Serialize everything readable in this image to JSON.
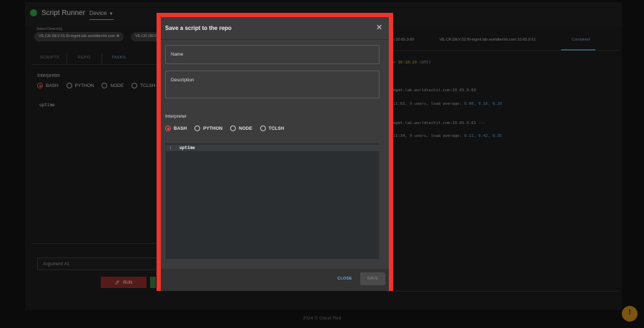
{
  "app": {
    "title": "Script Runner",
    "device_select": "Device",
    "devices_label": "Select Device(s)",
    "device_chips": [
      "VE.CR.DEV.01.f0-mgmt.lab.worldtechit.com",
      "VE.CR.DEV"
    ],
    "left_tabs": [
      "SCRIPTS",
      "REPO",
      "TASKS"
    ],
    "interpreter_label": "Interpreter",
    "interpreters": [
      "BASH",
      "PYTHON",
      "NODE",
      "TCLSH"
    ],
    "selected_interpreter": "BASH",
    "script_line": "uptime",
    "argument_placeholder": "Argument #1",
    "run_label": "RUN"
  },
  "output": {
    "tabs": [
      ".com:10.65.9.60",
      "VE.CR.DEV.02.f0-mgmt.lab.worldtechit.com:10.65.9.61",
      "Combined"
    ],
    "lines": {
      "l1_pre": "n ",
      "l1_time": "16:10:29",
      "l1_post": " (UTC)",
      "l2": "mgmt.lab.worldtechit.com:10.65.9.60",
      "l3_pre": "11:02,  ",
      "l3_users": "0",
      "l3_mid": " users,  load average: ",
      "l3_loads": "0.00, 0.16, 0.20",
      "l4": "mgmt.lab.worldtechit.com:10.65.9.61 ---",
      "l5_pre": "11:34,  ",
      "l5_users": "0",
      "l5_mid": " users,  load average: ",
      "l5_loads": "0.11, 0.42, 0.35"
    }
  },
  "dialog": {
    "title": "Save a script to the repo",
    "name_placeholder": "Name",
    "description_placeholder": "Description",
    "interpreter_label": "Interpreter",
    "interpreters": [
      "BASH",
      "PYTHON",
      "NODE",
      "TCLSH"
    ],
    "selected_interpreter": "BASH",
    "code_line_number": "1",
    "code": "uptime",
    "close_label": "CLOSE",
    "save_label": "SAVE"
  },
  "footer": "2024 © Cloud Red",
  "colors": {
    "accent_red": "#f0332b",
    "link_blue": "#6fa8dc",
    "status_green": "#2ea043",
    "fab_orange": "#c98a1a"
  }
}
